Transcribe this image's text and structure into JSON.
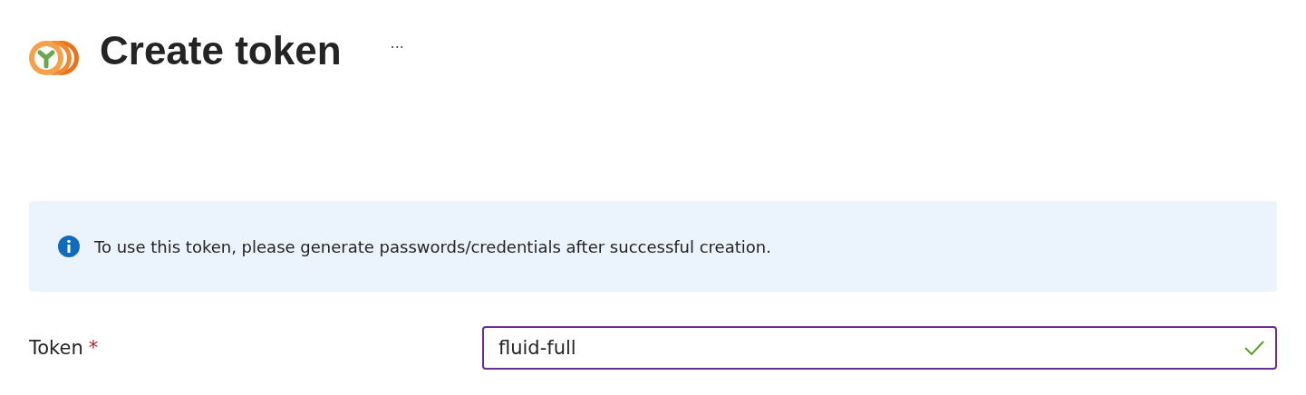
{
  "header": {
    "title": "Create token",
    "more": "···"
  },
  "info_banner": {
    "message": "To use this token, please generate passwords/credentials after successful creation."
  },
  "fields": [
    {
      "label": "Token",
      "required_mark": "*",
      "value": "fluid-full",
      "valid": true,
      "focused": true
    }
  ]
}
